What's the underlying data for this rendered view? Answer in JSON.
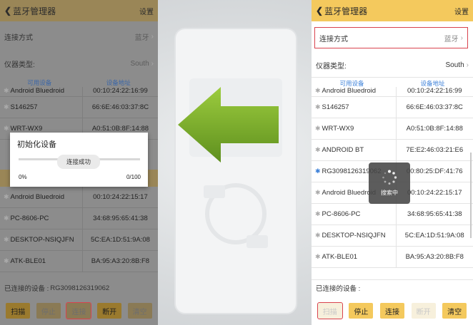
{
  "arrow_color": "#7aad2a",
  "left": {
    "title": "蓝牙管理器",
    "back_icon": "chevron-left-icon",
    "settings": "设置",
    "connect_method_label": "连接方式",
    "connect_method_value": "蓝牙",
    "instrument_label": "仪器类型:",
    "instrument_value": "South",
    "col_device": "可用设备",
    "col_address": "设备地址",
    "partial_top": {
      "name": "Android Bluedroid",
      "address": "00:10:24:22:16:99"
    },
    "devices": [
      {
        "name": "S146257",
        "address": "66:6E:46:03:37:8C"
      },
      {
        "name": "WRT-WX9",
        "address": "A0:51:0B:8F:14:88"
      }
    ],
    "devices_below": [
      {
        "name": "Android Bluedroid",
        "address": "00:10:24:22:15:17"
      },
      {
        "name": "PC-8606-PC",
        "address": "34:68:95:65:41:38"
      },
      {
        "name": "DESKTOP-NSIQJFN",
        "address": "5C:EA:1D:51:9A:08"
      },
      {
        "name": "ATK-BLE01",
        "address": "BA:95:A3:20:8B:F8"
      }
    ],
    "connected_label": "已连接的设备 :",
    "connected_value": "RG3098126319062",
    "buttons": {
      "scan": "扫描",
      "stop": "停止",
      "connect": "连接",
      "disconnect": "断开",
      "clear": "清空"
    },
    "dialog": {
      "title": "初始化设备",
      "status": "连接成功",
      "progress_start": "0%",
      "progress_end": "0/100",
      "progress_fraction": 0
    }
  },
  "right": {
    "title": "蓝牙管理器",
    "back_icon": "chevron-left-icon",
    "settings": "设置",
    "connect_method_label": "连接方式",
    "connect_method_value": "蓝牙",
    "instrument_label": "仪器类型:",
    "instrument_value": "South",
    "col_device": "可用设备",
    "col_address": "设备地址",
    "partial_top": {
      "name": "Android Bluedroid",
      "address": "00:10:24:22:16:99"
    },
    "devices": [
      {
        "name": "S146257",
        "address": "66:6E:46:03:37:8C"
      },
      {
        "name": "WRT-WX9",
        "address": "A0:51:0B:8F:14:88"
      },
      {
        "name": "ANDROID BT",
        "address": "7E:E2:46:03:21:E6"
      },
      {
        "name": "RG3098126319062",
        "address": "00:80:25:DF:41:76"
      },
      {
        "name": "Android Bluedroid",
        "address": "00:10:24:22:15:17"
      },
      {
        "name": "PC-8606-PC",
        "address": "34:68:95:65:41:38"
      },
      {
        "name": "DESKTOP-NSIQJFN",
        "address": "5C:EA:1D:51:9A:08"
      },
      {
        "name": "ATK-BLE01",
        "address": "BA:95:A3:20:8B:F8"
      }
    ],
    "connected_label": "已连接的设备 :",
    "buttons": {
      "scan": "扫描",
      "stop": "停止",
      "connect": "连接",
      "disconnect": "断开",
      "clear": "清空"
    },
    "toast": "搜索中"
  }
}
